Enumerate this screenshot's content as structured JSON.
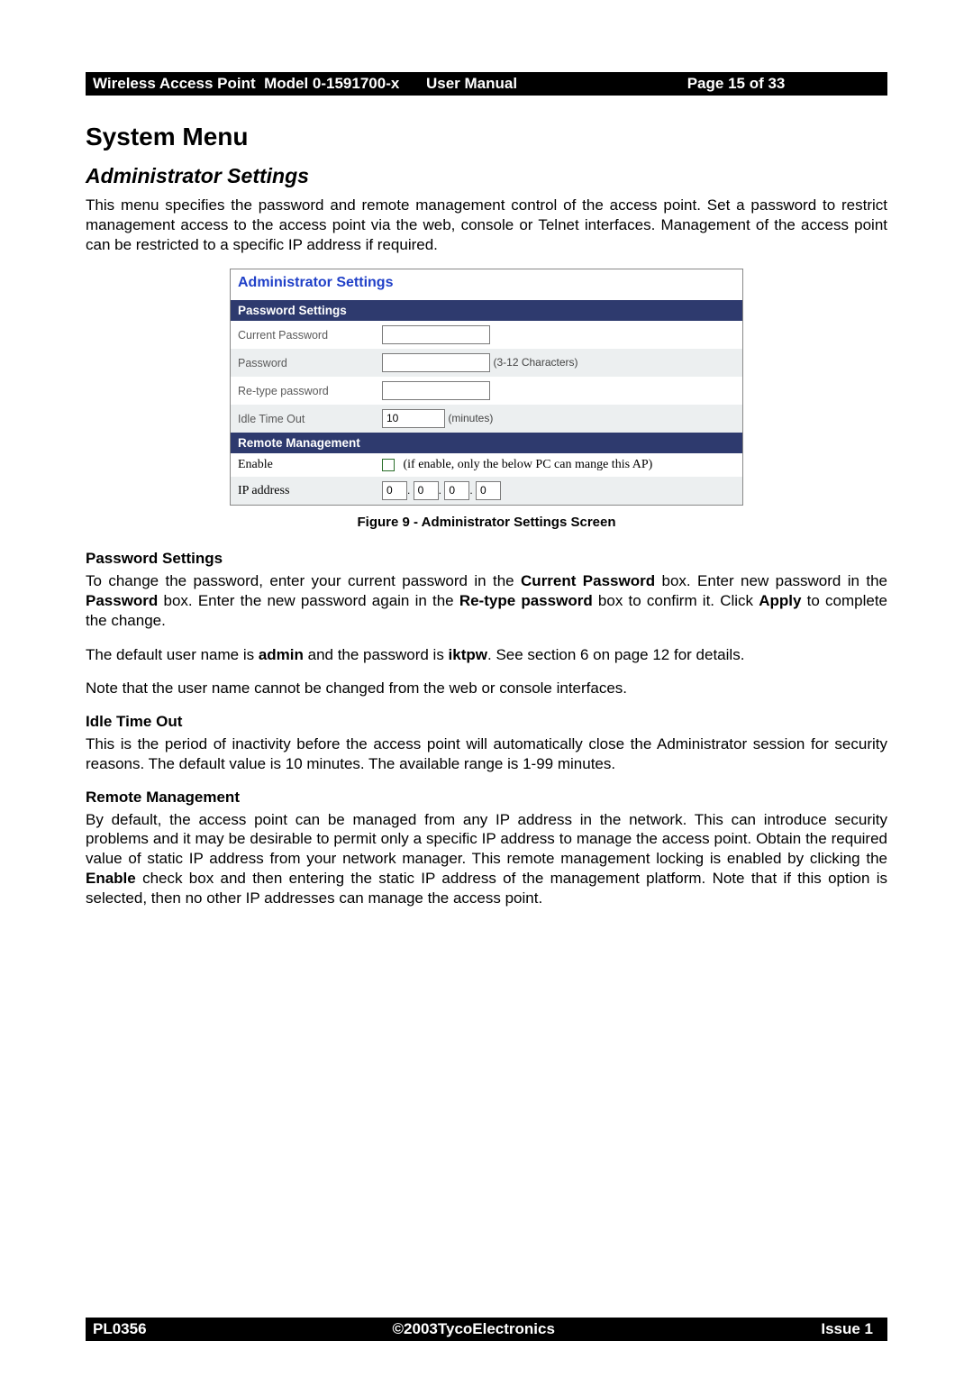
{
  "header_bar": {
    "left": "Wireless Access Point  Model 0-1591700-x",
    "middle": "User Manual",
    "right": " Page 15 of 33"
  },
  "title_h1": "System Menu",
  "title_h2": "Administrator Settings",
  "intro": "This menu specifies the password and remote management control of the access point. Set a password to restrict management access to the access point via the web, console or Telnet interfaces. Management of the access point can be restricted to a specific IP address if required.",
  "screenshot": {
    "title": "Administrator Settings",
    "sections": {
      "password_header": "Password Settings",
      "remote_header": "Remote Management"
    },
    "labels": {
      "current_password": "Current Password",
      "password": "Password",
      "retype": "Re-type password",
      "idle": "Idle Time Out",
      "enable": "Enable",
      "ip_address": "IP address"
    },
    "values": {
      "idle": "10",
      "idle_unit": " (minutes)",
      "password_hint": "(3-12 Characters)",
      "enable_hint": "(if enable, only the below PC can mange this AP)",
      "ip_one": "0",
      "ip_two": "0",
      "ip_three": "0",
      "ip_four": "0"
    }
  },
  "figure_caption": "Figure 9 - Administrator Settings Screen",
  "body": {
    "pw_heading": "Password Settings",
    "pw_p1a": "To change the password, enter your current password in the ",
    "pw_p1_bold1": "Current Password",
    "pw_p1b": " box. Enter new password in the ",
    "pw_p1_bold2": "Password",
    "pw_p1c": " box. Enter the new password again in the ",
    "pw_p1_bold3": "Re-type password",
    "pw_p1d": " box to confirm it. Click ",
    "pw_p1_bold4": "Apply",
    "pw_p1e": " to complete the change.",
    "pw_p2a": "The default user name is ",
    "pw_p2_bold1": "admin",
    "pw_p2b": " and the password is ",
    "pw_p2_bold2": "iktpw",
    "pw_p2c": ". See section 6 on page 12 for details.",
    "pw_p3": "Note that the user name cannot be changed from the web or console interfaces.",
    "idle_heading": "Idle Time Out",
    "idle_p": "This is the period of inactivity before the access point will automatically close the Administrator session for security reasons. The default value is 10 minutes. The available range is 1-99 minutes.",
    "rm_heading": "Remote Management",
    "rm_p1a": "By default, the access point can be managed from any IP address in the network. This can introduce security problems and it may be desirable to permit only a specific IP address to manage the access point. Obtain the required value of static IP address from your network manager. This remote management locking is enabled by clicking the ",
    "rm_p1_bold": "Enable",
    "rm_p1b": " check box and then entering the static IP address of the management platform. Note that if this option is selected, then no other IP addresses can manage the access point."
  },
  "footer_bar": {
    "left": "PL0356",
    "middle": "©2003TycoElectronics",
    "right": "Issue 1"
  }
}
